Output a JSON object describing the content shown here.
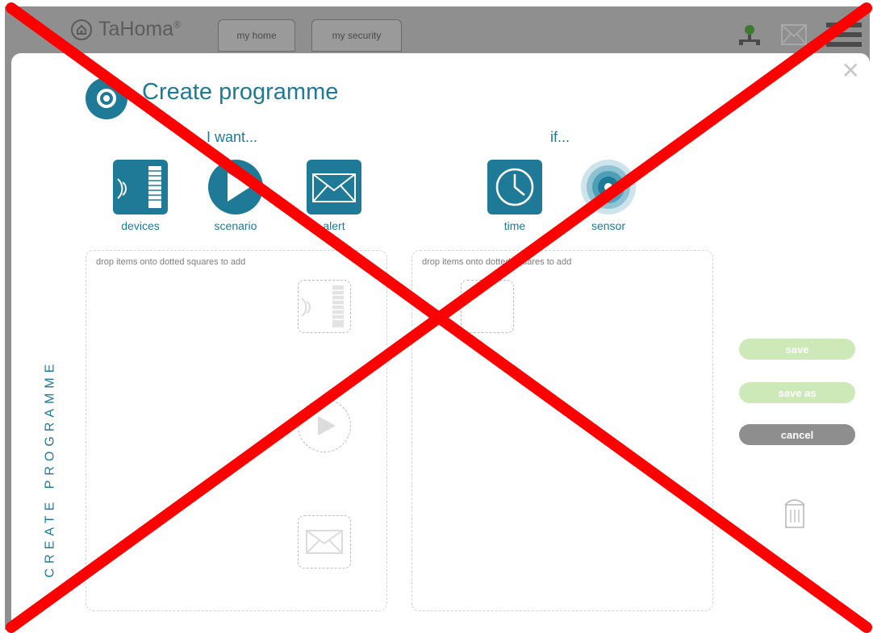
{
  "app": {
    "logo_text": "TaHoma",
    "logo_mark": "®"
  },
  "top_tabs": [
    {
      "label": "my home"
    },
    {
      "label": "my security"
    }
  ],
  "modal": {
    "title": "Create programme",
    "side_label": "CREATE PROGRAMME",
    "want_heading": "I want...",
    "if_heading": "if...",
    "want_items": [
      {
        "label": "devices",
        "icon": "devices-icon"
      },
      {
        "label": "scenario",
        "icon": "play-icon"
      },
      {
        "label": "alert",
        "icon": "envelope-icon"
      }
    ],
    "if_items": [
      {
        "label": "time",
        "icon": "clock-icon"
      },
      {
        "label": "sensor",
        "icon": "sensor-icon"
      }
    ],
    "drop_hint_left": "drop items onto dotted squares to add",
    "drop_hint_right": "drop items onto dotted squares to add",
    "buttons": {
      "save": "save",
      "save_as": "save as",
      "cancel": "cancel"
    }
  },
  "colors": {
    "accent": "#1f7a97",
    "overlay_bg": "#8f8f8f",
    "save_btn": "#cde9b8",
    "cancel_btn": "#8e8e8e",
    "cross": "#ff0000"
  }
}
